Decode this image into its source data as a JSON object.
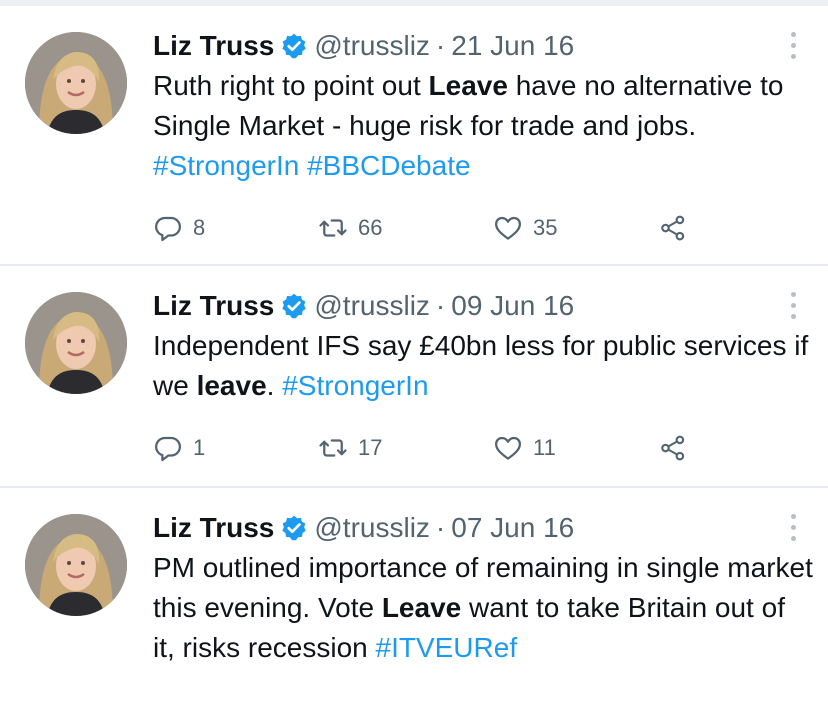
{
  "colors": {
    "text": "#0f1419",
    "muted": "#536471",
    "link": "#1d9bf0",
    "verified": "#1d9bf0",
    "divider": "#e6ecf0"
  },
  "icons": [
    "verified-badge-icon",
    "more-options-icon",
    "reply-icon",
    "retweet-icon",
    "like-icon",
    "share-icon"
  ],
  "tweets": [
    {
      "author": "Liz Truss",
      "handle": "@trussliz",
      "separator": "·",
      "date": "21 Jun 16",
      "text": [
        {
          "t": "Ruth right to point out "
        },
        {
          "t": "Leave",
          "bold": true
        },
        {
          "t": " have no alternative to Single Market - huge risk for trade and jobs. "
        },
        {
          "t": "#StrongerIn",
          "tag": true
        },
        {
          "t": " "
        },
        {
          "t": "#BBCDebate",
          "tag": true
        }
      ],
      "stats": {
        "replies": "8",
        "retweets": "66",
        "likes": "35"
      }
    },
    {
      "author": "Liz Truss",
      "handle": "@trussliz",
      "separator": "·",
      "date": "09 Jun 16",
      "text": [
        {
          "t": "Independent IFS say £40bn less for public services if we "
        },
        {
          "t": "leave",
          "bold": true
        },
        {
          "t": ". "
        },
        {
          "t": "#StrongerIn",
          "tag": true
        }
      ],
      "stats": {
        "replies": "1",
        "retweets": "17",
        "likes": "11"
      }
    },
    {
      "author": "Liz Truss",
      "handle": "@trussliz",
      "separator": "·",
      "date": "07 Jun 16",
      "text": [
        {
          "t": "PM outlined importance of remaining in single market this evening. Vote "
        },
        {
          "t": "Leave",
          "bold": true
        },
        {
          "t": " want to take Britain out of it, risks recession "
        },
        {
          "t": "#ITVEURef",
          "tag": true
        }
      ],
      "stats": null
    }
  ]
}
